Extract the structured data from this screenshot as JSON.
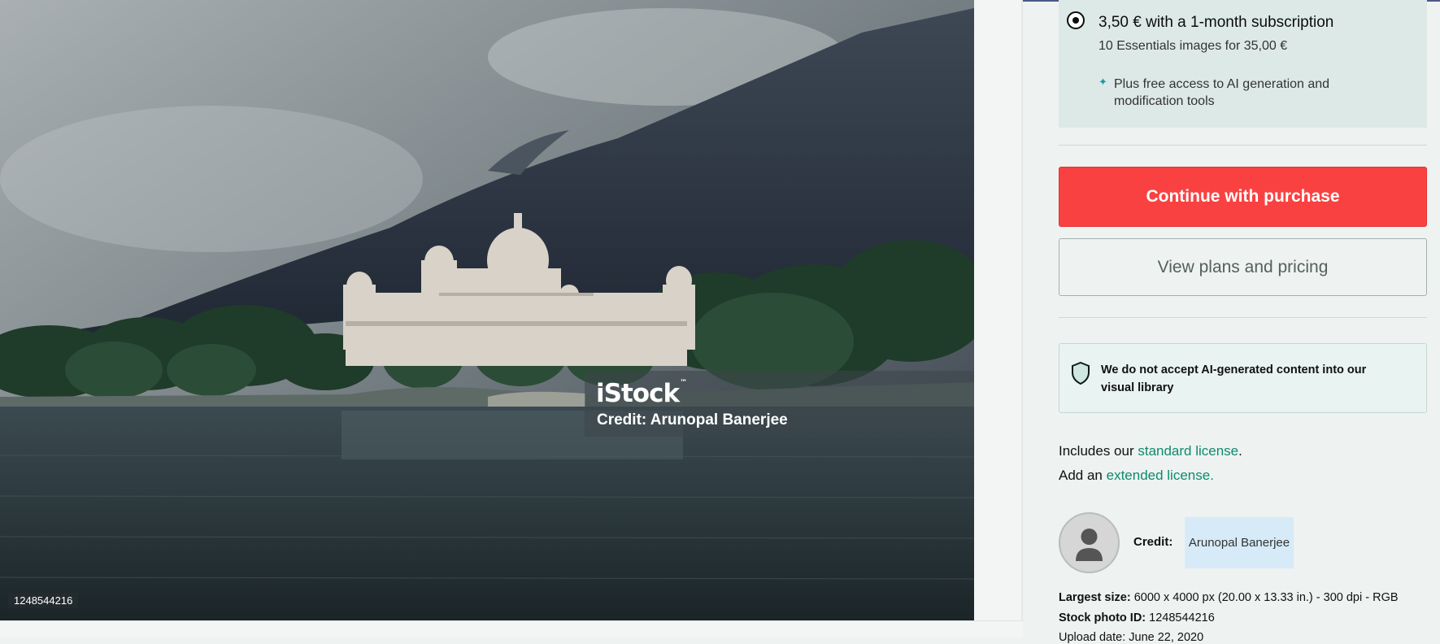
{
  "photo": {
    "watermark_logo": "iStock",
    "watermark_tm": "™",
    "watermark_credit": "Credit: Arunopal Banerjee",
    "photo_id_label": "1248544216"
  },
  "subscription": {
    "title": "3,50 € with a 1-month subscription",
    "subtitle": "10 Essentials images for 35,00 €",
    "ai_perk": "Plus free access to AI generation and modification tools",
    "selected": true
  },
  "actions": {
    "purchase_label": "Continue with purchase",
    "plans_label": "View plans and pricing"
  },
  "notice": {
    "text": "We do not accept AI-generated content into our visual library"
  },
  "license": {
    "includes_prefix": "Includes our ",
    "standard_link": "standard license",
    "includes_suffix": ".",
    "add_prefix": "Add an ",
    "extended_link": "extended license."
  },
  "credit": {
    "label": "Credit:",
    "name": "Arunopal Banerjee"
  },
  "details": {
    "largest_size_label": "Largest size:",
    "largest_size_value": "6000 x 4000 px (20.00 x 13.33 in.) - 300 dpi - RGB",
    "stock_id_label": "Stock photo ID:",
    "stock_id_value": "1248544216",
    "uploaded_partial": "Upload date: June 22, 2020"
  },
  "colors": {
    "purchase": "#fa4141",
    "link": "#0f8a6e",
    "panel_bg": "#eef2f1",
    "sub_card": "#dde9e7"
  }
}
